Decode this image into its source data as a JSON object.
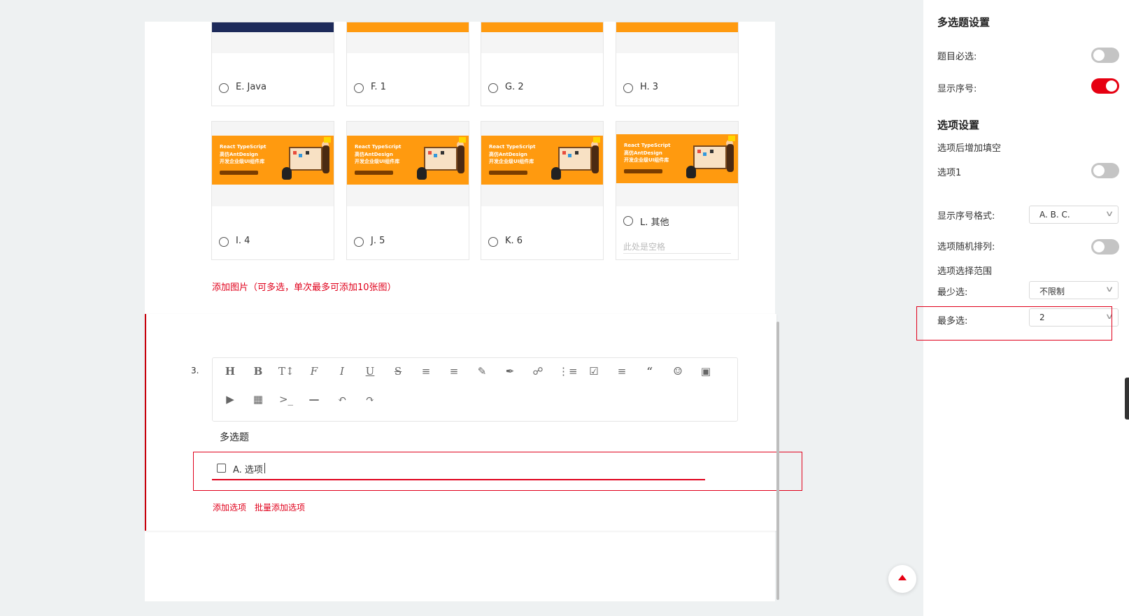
{
  "top_options": [
    {
      "label": "E. Java"
    },
    {
      "label": "F. 1"
    },
    {
      "label": "G. 2"
    },
    {
      "label": "H. 3"
    }
  ],
  "image_options": [
    {
      "label": "I.  4"
    },
    {
      "label": "J. 5"
    },
    {
      "label": "K. 6"
    },
    {
      "label": "L. 其他",
      "fill_placeholder": "此处是空格"
    }
  ],
  "banner": {
    "line1": "React TypeScript",
    "line2": "高仿AntDesign",
    "line3": "开发企业级UI组件库"
  },
  "add_image_link": "添加图片（可多选，单次最多可添加10张图）",
  "question": {
    "number": "3.",
    "title": "多选题",
    "option_text": "A. 选项",
    "add_option": "添加选项",
    "batch_add_option": "批量添加选项"
  },
  "toolbar": {
    "icons": [
      "heading-icon",
      "bold-icon",
      "font-size-icon",
      "font-family-icon",
      "italic-icon",
      "underline-icon",
      "strikethrough-icon",
      "indent-icon",
      "line-height-icon",
      "text-color-icon",
      "background-color-icon",
      "link-icon",
      "list-icon",
      "todo-icon",
      "justify-icon",
      "quote-icon",
      "emoticon-icon",
      "image-icon",
      "video-icon",
      "table-icon",
      "code-icon",
      "divider-icon",
      "undo-icon",
      "redo-icon"
    ]
  },
  "settings": {
    "title": "多选题设置",
    "required_label": "题目必选:",
    "required_on": false,
    "show_number_label": "显示序号:",
    "show_number_on": true,
    "option_settings_title": "选项设置",
    "fill_after_option_label": "选项后增加填空",
    "option1_label": "选项1",
    "option1_on": false,
    "number_format_label": "显示序号格式:",
    "number_format_value": "A. B. C.",
    "random_order_label": "选项随机排列:",
    "random_order_on": false,
    "select_range_label": "选项选择范围",
    "min_label": "最少选:",
    "min_value": "不限制",
    "max_label": "最多选:",
    "max_value": "2"
  },
  "colors": {
    "accent": "#e60012",
    "banner_orange": "#ff9a0f"
  }
}
